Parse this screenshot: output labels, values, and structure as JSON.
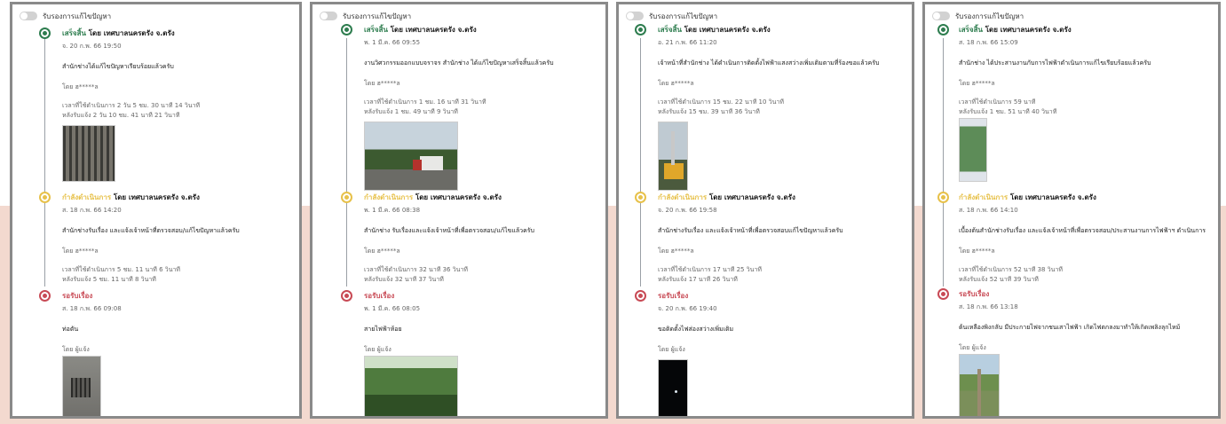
{
  "panels": [
    {
      "toggle_label": "รับรองการแก้ไขปัญหา",
      "items": [
        {
          "status": "เสร็จสิ้น",
          "by_org": "โดย เทศบาลนครตรัง จ.ตรัง",
          "date": "จ. 20 ก.พ. 66 19:50",
          "desc": "สำนักช่างได้แก้ไขปัญหาเรียบร้อยแล้วครับ",
          "by": "โดย ฮ*****ล",
          "dur1": "เวลาที่ใช้ดำเนินการ 2 วัน 5 ชม. 30 นาที 14 วินาที",
          "dur2": "หลังรับแจ้ง 2 วัน 10 ชม. 41 นาที 21 วินาที",
          "photo": "photo-drain-grate"
        },
        {
          "status": "กำลังดำเนินการ",
          "by_org": "โดย เทศบาลนครตรัง จ.ตรัง",
          "date": "ส. 18 ก.พ. 66 14:20",
          "desc": "สำนักช่างรับเรื่อง และแจ้งเจ้าหน้าที่ตรวจสอบ/แก้ไขปัญหาแล้วครับ",
          "by": "โดย ฮ*****ล",
          "dur1": "เวลาที่ใช้ดำเนินการ 5 ชม. 11 นาที 6 วินาที",
          "dur2": "หลังรับแจ้ง 5 ชม. 11 นาที 8 วินาที"
        },
        {
          "status": "รอรับเรื่อง",
          "by_org": "",
          "date": "ส. 18 ก.พ. 66 09:08",
          "desc": "ท่อตัน",
          "by": "โดย ผู้แจ้ง",
          "photo": "photo-drain-cover"
        }
      ]
    },
    {
      "toggle_label": "รับรองการแก้ไขปัญหา",
      "items": [
        {
          "status": "เสร็จสิ้น",
          "by_org": "โดย เทศบาลนครตรัง จ.ตรัง",
          "date": "พ. 1 มี.ค. 66 09:55",
          "desc": "งานวิศวกรรมออกแบบจราจร สำนักช่าง ได้แก้ไขปัญหาเสร็จสิ้นแล้วครับ",
          "by": "โดย ฮ*****ล",
          "dur1": "เวลาที่ใช้ดำเนินการ 1 ชม. 16 นาที 31 วินาที",
          "dur2": "หลังรับแจ้ง 1 ชม. 49 นาที 9 วินาที",
          "photo": "photo-street-truck"
        },
        {
          "status": "กำลังดำเนินการ",
          "by_org": "โดย เทศบาลนครตรัง จ.ตรัง",
          "date": "พ. 1 มี.ค. 66 08:38",
          "desc": "สำนักช่าง รับเรื่องและแจ้งเจ้าหน้าที่เพื่อตรวจสอบ/แก้ไขแล้วครับ",
          "by": "โดย ฮ*****ล",
          "dur1": "เวลาที่ใช้ดำเนินการ 32 นาที 36 วินาที",
          "dur2": "หลังรับแจ้ง 32 นาที 37 วินาที"
        },
        {
          "status": "รอรับเรื่อง",
          "by_org": "",
          "date": "พ. 1 มี.ค. 66 08:05",
          "desc": "สายไฟฟ้าห้อย",
          "by": "โดย ผู้แจ้ง",
          "photo": "photo-trees-wire"
        }
      ]
    },
    {
      "toggle_label": "รับรองการแก้ไขปัญหา",
      "items": [
        {
          "status": "เสร็จสิ้น",
          "by_org": "โดย เทศบาลนครตรัง จ.ตรัง",
          "date": "อ. 21 ก.พ. 66 11:20",
          "desc": "เจ้าหน้าที่สำนักช่าง ได้ดำเนินการติดตั้งไฟฟ้าแสงสว่างเพิ่มเติมตามที่ร้องขอแล้วครับ",
          "by": "โดย ฮ*****ล",
          "dur1": "เวลาที่ใช้ดำเนินการ 15 ชม. 22 นาที 10 วินาที",
          "dur2": "หลังรับแจ้ง 15 ชม. 39 นาที 36 วินาที",
          "photo": "photo-bucket-truck"
        },
        {
          "status": "กำลังดำเนินการ",
          "by_org": "โดย เทศบาลนครตรัง จ.ตรัง",
          "date": "จ. 20 ก.พ. 66 19:58",
          "desc": "สำนักช่างรับเรื่อง และแจ้งเจ้าหน้าที่เพื่อตรวจสอบแก้ไขปัญหาแล้วครับ",
          "by": "โดย ฮ*****ล",
          "dur1": "เวลาที่ใช้ดำเนินการ 17 นาที 25 วินาที",
          "dur2": "หลังรับแจ้ง 17 นาที 26 วินาที"
        },
        {
          "status": "รอรับเรื่อง",
          "by_org": "",
          "date": "จ. 20 ก.พ. 66 19:40",
          "desc": "ขอติดตั้งไฟส่องสว่างเพิ่มเติม",
          "by": "โดย ผู้แจ้ง",
          "photo": "photo-night-dark"
        }
      ]
    },
    {
      "toggle_label": "รับรองการแก้ไขปัญหา",
      "items": [
        {
          "status": "เสร็จสิ้น",
          "by_org": "โดย เทศบาลนครตรัง จ.ตรัง",
          "date": "ส. 18 ก.พ. 66 15:09",
          "desc": "สำนักช่าง ได้ประสานงานกับการไฟฟ้าดำเนินการแก้ไขเรียบร้อยแล้วครับ",
          "by": "โดย ฮ*****ล",
          "dur1": "เวลาที่ใช้ดำเนินการ 59 นาที",
          "dur2": "หลังรับแจ้ง 1 ชม. 51 นาที 40 วินาที",
          "photo": "photo-phone-screenshot"
        },
        {
          "status": "กำลังดำเนินการ",
          "by_org": "โดย เทศบาลนครตรัง จ.ตรัง",
          "date": "ส. 18 ก.พ. 66 14:10",
          "desc": "เบื้องต้นสำนักช่างรับเรื่อง และแจ้งเจ้าหน้าที่เพื่อตรวจสอบ/ประสานงานการไฟฟ้าฯ ดำเนินการ",
          "by": "โดย ฮ*****ล",
          "dur1": "เวลาที่ใช้ดำเนินการ 52 นาที 38 วินาที",
          "dur2": "หลังรับแจ้ง 52 นาที 39 วินาที"
        },
        {
          "status": "รอรับเรื่อง",
          "by_org": "",
          "date": "ส. 18 ก.พ. 66 13:18",
          "desc": "ต้นเหลืองพิงกลับ มีประกายไฟจากชนเสาไฟฟ้า เกิดไฟตกลงมาทำให้เกิดเพลิงลุกไหม้",
          "by": "โดย ผู้แจ้ง",
          "photo": "photo-palm-tree"
        }
      ]
    }
  ]
}
